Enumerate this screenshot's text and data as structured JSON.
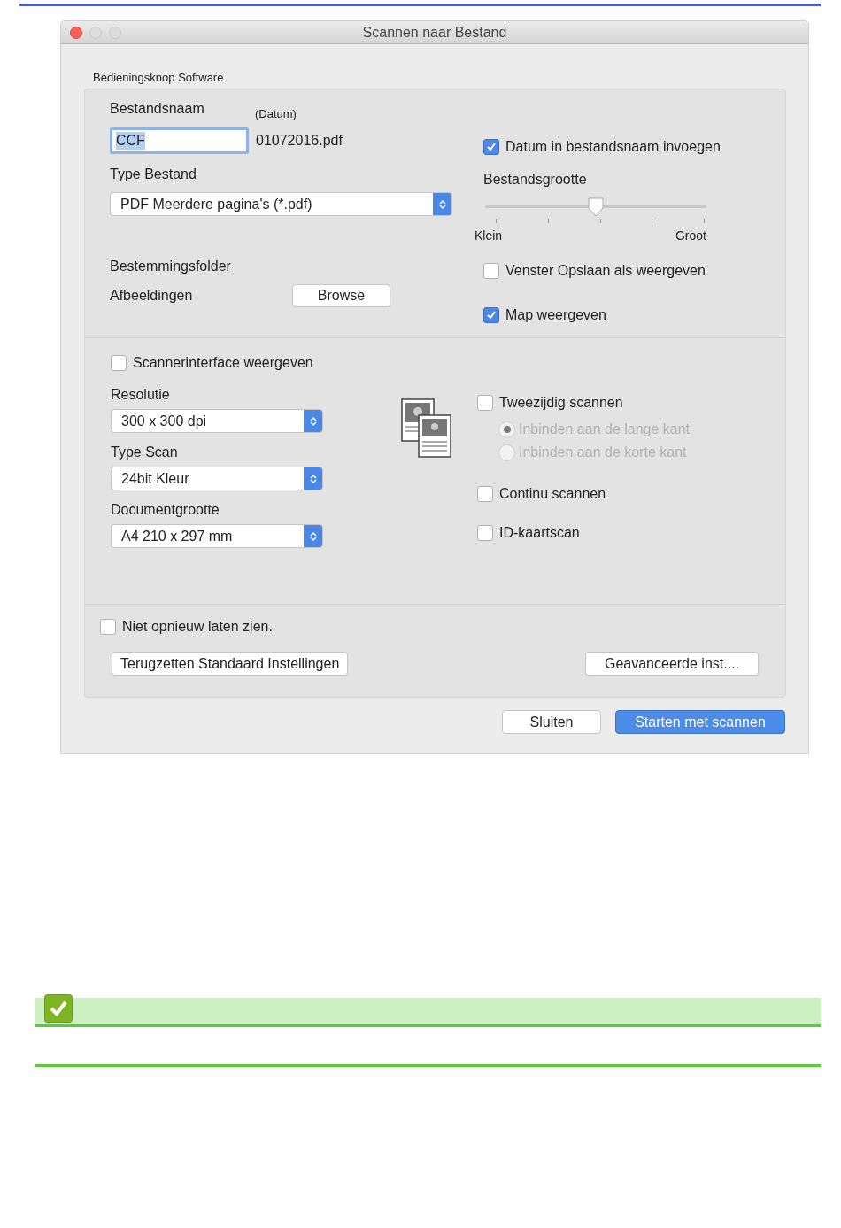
{
  "window": {
    "title": "Scannen naar Bestand"
  },
  "group_label": "Bedieningsknop Software",
  "file_name": {
    "label": "Bestandsnaam",
    "date_label": "(Datum)",
    "value": "CCF",
    "date_value": "01072016.pdf"
  },
  "file_type": {
    "label": "Type Bestand",
    "value": "PDF Meerdere pagina's (*.pdf)"
  },
  "insert_date": {
    "label": "Datum in bestandsnaam invoegen",
    "checked": true
  },
  "file_size": {
    "label": "Bestandsgrootte",
    "level": 0.5,
    "min_label": "Klein",
    "max_label": "Groot"
  },
  "destination": {
    "label": "Bestemmingsfolder",
    "folder": "Afbeeldingen",
    "browse": "Browse"
  },
  "show_save_as": {
    "label": "Venster Opslaan als weergeven",
    "checked": false
  },
  "show_folder": {
    "label": "Map weergeven",
    "checked": true
  },
  "scanner_interface": {
    "label": "Scannerinterface weergeven",
    "checked": false
  },
  "selects": [
    {
      "label": "Resolutie",
      "value": "300 x 300 dpi"
    },
    {
      "label": "Type Scan",
      "value": "24bit Kleur"
    },
    {
      "label": "Documentgrootte",
      "value": "A4 210 x 297 mm"
    }
  ],
  "duplex": {
    "label": "Tweezijdig scannen",
    "checked": false,
    "options": [
      {
        "label": "Inbinden aan de lange kant",
        "selected": true,
        "disabled": true
      },
      {
        "label": "Inbinden aan de korte kant",
        "selected": false,
        "disabled": true
      }
    ]
  },
  "options": [
    {
      "label": "Continu scannen",
      "checked": false
    },
    {
      "label": "ID-kaartscan",
      "checked": false
    }
  ],
  "dont_show": {
    "label": "Niet opnieuw laten zien.",
    "checked": false
  },
  "buttons": {
    "reset": "Terugzetten Standaard Instellingen",
    "advanced": "Geavanceerde inst....",
    "close": "Sluiten",
    "start": "Starten met scannen"
  }
}
